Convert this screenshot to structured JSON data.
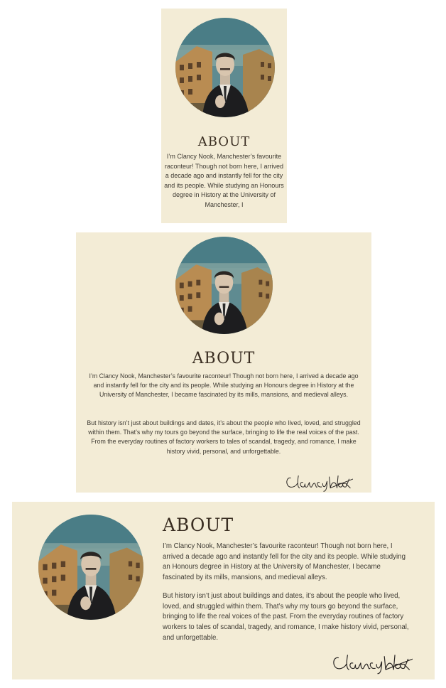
{
  "about": {
    "heading": "ABOUT",
    "paragraph_1": "I’m Clancy Nook, Manchester’s favourite raconteur! Though not born here, I arrived a decade ago and instantly fell for the city and its people. While studying an Honours degree in History at the University of Manchester, I became fascinated by its mills, mansions, and medieval alleys.",
    "paragraph_2": "But history isn’t just about buildings and dates, it’s about the people who lived, loved, and struggled within them. That’s why my tours go beyond the surface, bringing to life the real voices of the past. From the everyday routines of factory workers to tales of scandal, tragedy, and romance, I make history vivid, personal, and unforgettable.",
    "paragraph_1_truncated": "I’m Clancy Nook, Manchester’s favourite raconteur! Though not born here, I arrived a decade ago and instantly fell for the city and its people. While studying an Honours degree in History at the University of Manchester, I",
    "signature": "ClancyNook"
  },
  "colors": {
    "card_background": "#f3ecd6",
    "heading": "#3a2e22",
    "body_text": "#3e3a33"
  },
  "icons": {
    "portrait": "portrait-photo",
    "signature": "signature-image"
  }
}
